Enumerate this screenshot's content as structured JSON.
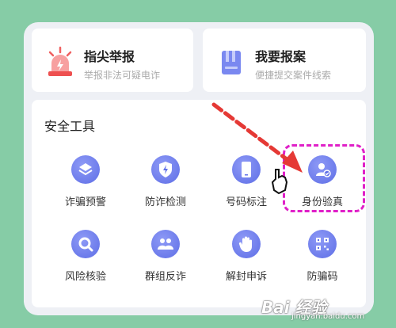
{
  "top_cards": {
    "report": {
      "title": "指尖举报",
      "subtitle": "举报非法可疑电诈"
    },
    "case": {
      "title": "我要报案",
      "subtitle": "便捷提交案件线索"
    }
  },
  "tools_section": {
    "title": "安全工具",
    "items": [
      {
        "label": "诈骗预警",
        "icon": "layers-icon"
      },
      {
        "label": "防诈检测",
        "icon": "shield-bolt-icon"
      },
      {
        "label": "号码标注",
        "icon": "phone-icon"
      },
      {
        "label": "身份验真",
        "icon": "user-verified-icon"
      },
      {
        "label": "风险核验",
        "icon": "search-icon"
      },
      {
        "label": "群组反诈",
        "icon": "group-icon"
      },
      {
        "label": "解封申诉",
        "icon": "hand-icon"
      },
      {
        "label": "防骗码",
        "icon": "qr-code-icon"
      }
    ]
  },
  "annotation": {
    "color": "#e020c8",
    "arrow_color": "#e53935"
  },
  "colors": {
    "icon_blue": "#6070e8",
    "background": "#86cca6",
    "panel": "#eef0f5"
  },
  "watermark": {
    "logo": "Bai 经验",
    "url": "jingyan.baidu.com"
  }
}
